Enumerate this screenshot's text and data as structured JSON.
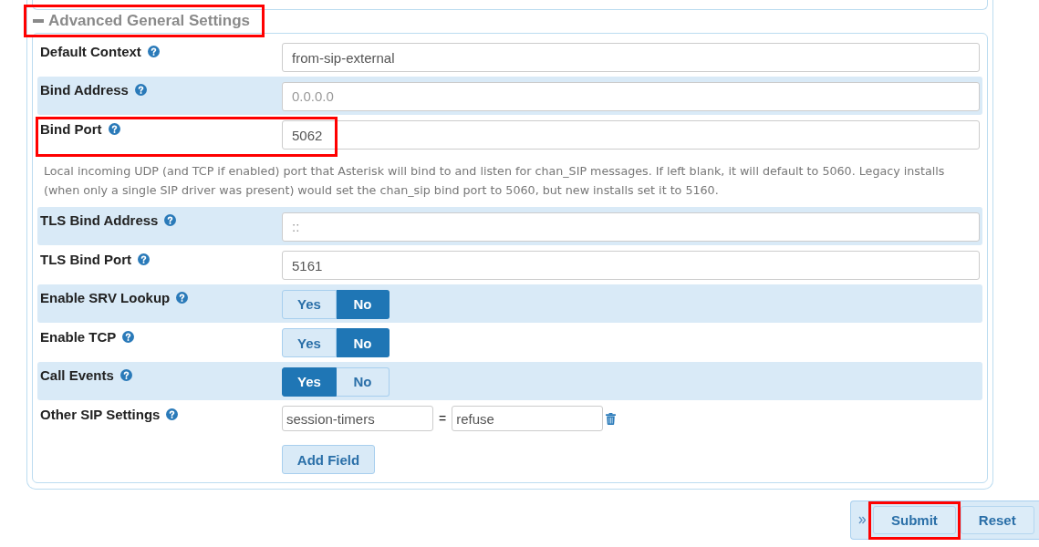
{
  "section": {
    "title": "Advanced General Settings",
    "expanded": true,
    "annotated": true
  },
  "fields": [
    {
      "kind": "text",
      "label": "Default Context",
      "value": "from-sip-external",
      "annotated": false
    },
    {
      "kind": "text",
      "label": "Bind Address",
      "placeholder": "0.0.0.0",
      "annotated": false
    },
    {
      "kind": "text",
      "label": "Bind Port",
      "value": "5062",
      "help_text": "Local incoming UDP (and TCP if enabled) port that Asterisk will bind to and listen for chan_SIP messages. If left blank, it will default to 5060. Legacy installs (when only a single SIP driver was present) would set the chan_sip bind port to 5060, but new installs set it to 5160.",
      "annotated": true
    },
    {
      "kind": "text",
      "label": "TLS Bind Address",
      "placeholder": "::",
      "annotated": false
    },
    {
      "kind": "text",
      "label": "TLS Bind Port",
      "value": "5161",
      "annotated": false
    },
    {
      "kind": "toggle",
      "label": "Enable SRV Lookup",
      "options": [
        {
          "label": "Yes",
          "selected": false
        },
        {
          "label": "No",
          "selected": true
        }
      ],
      "annotated": false
    },
    {
      "kind": "toggle",
      "label": "Enable TCP",
      "options": [
        {
          "label": "Yes",
          "selected": false
        },
        {
          "label": "No",
          "selected": true
        }
      ],
      "annotated": false
    },
    {
      "kind": "toggle",
      "label": "Call Events",
      "options": [
        {
          "label": "Yes",
          "selected": true
        },
        {
          "label": "No",
          "selected": false
        }
      ],
      "annotated": false
    },
    {
      "kind": "key_value",
      "label": "Other SIP Settings",
      "pairs": [
        {
          "key": "session-timers",
          "separator": "=",
          "value": "refuse"
        }
      ],
      "add_button": "Add Field",
      "annotated": false
    }
  ],
  "actions": {
    "buttons": [
      {
        "label": "Submit",
        "annotated": true
      },
      {
        "label": "Reset",
        "annotated": false
      }
    ]
  }
}
